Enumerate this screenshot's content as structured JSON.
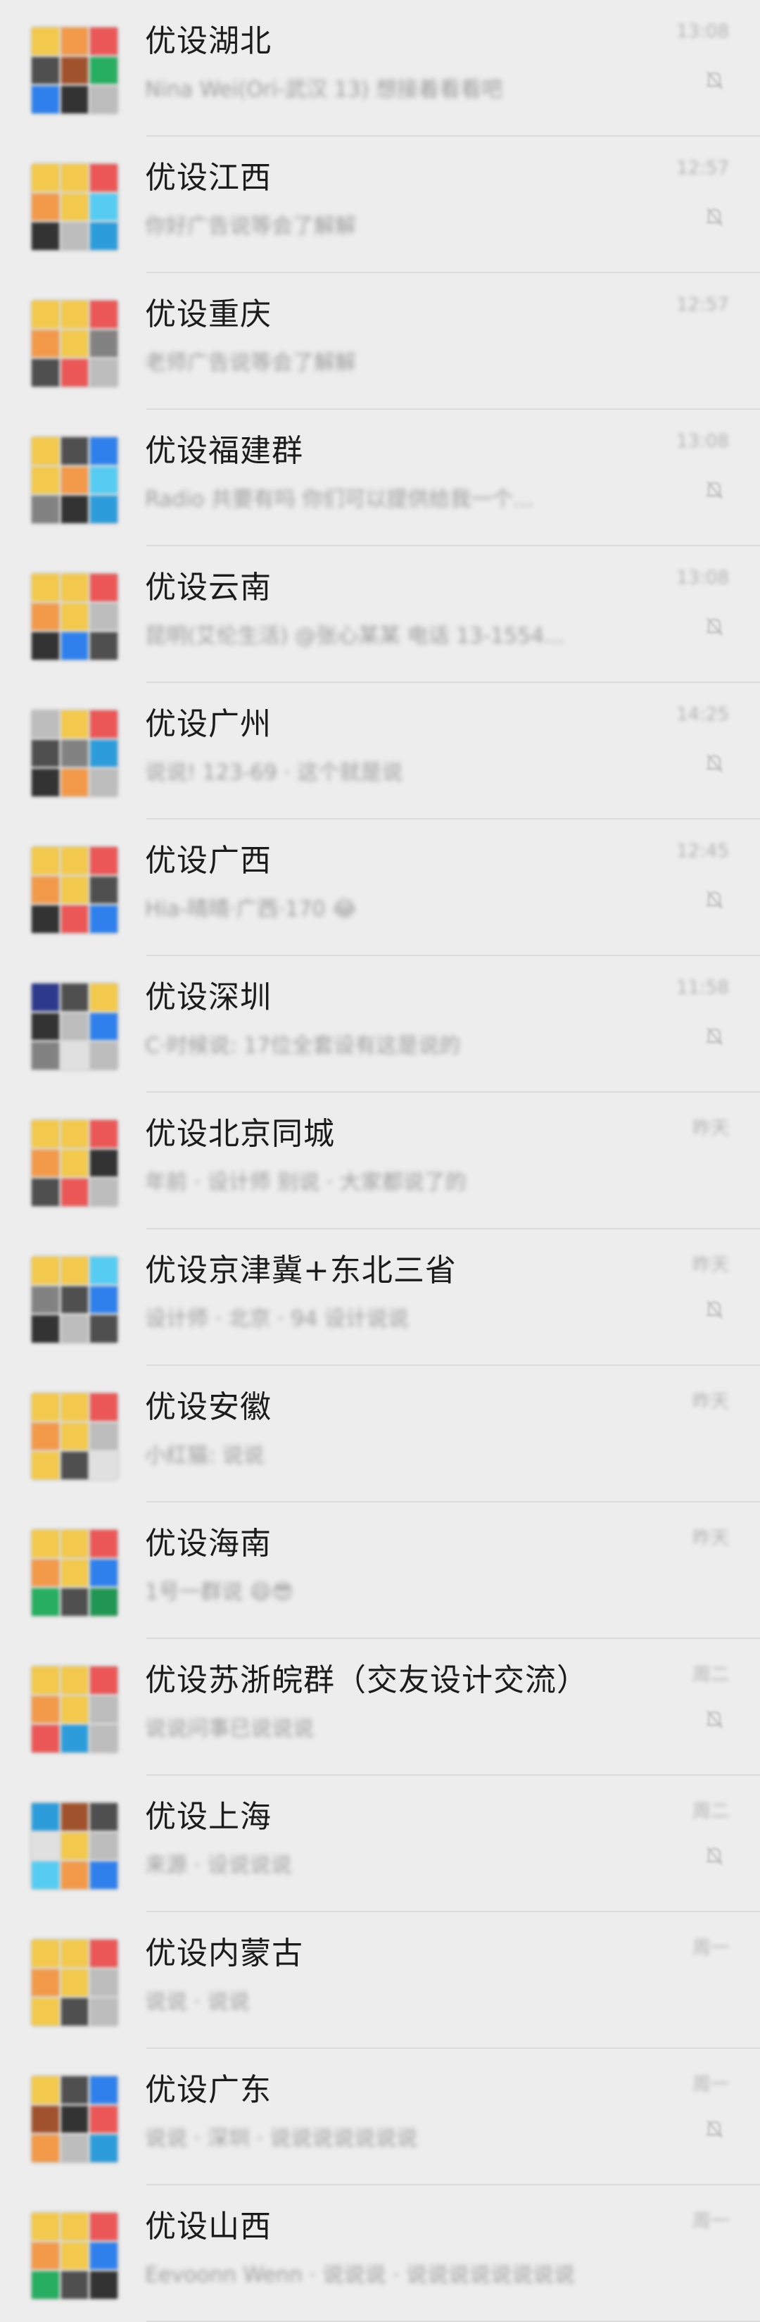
{
  "chats": [
    {
      "name": "优设湖北",
      "preview": "Nina Wei(Ori-武汉 13) 想接着看看吧",
      "time": "13:08",
      "muted": true,
      "avatar": [
        "#f2c94c",
        "#f2994a",
        "#eb5757",
        "#4f4f4f",
        "#a0522d",
        "#27ae60",
        "#2f80ed",
        "#333333",
        "#bdbdbd"
      ]
    },
    {
      "name": "优设江西",
      "preview": "你好广告说等会了解解",
      "time": "12:57",
      "muted": true,
      "avatar": [
        "#f2c94c",
        "#f2c94c",
        "#eb5757",
        "#f2994a",
        "#f2c94c",
        "#56ccf2",
        "#333333",
        "#bdbdbd",
        "#2d9cdb"
      ]
    },
    {
      "name": "优设重庆",
      "preview": "老师广告说等会了解解",
      "time": "12:57",
      "muted": false,
      "avatar": [
        "#f2c94c",
        "#f2c94c",
        "#eb5757",
        "#f2994a",
        "#f2c94c",
        "#828282",
        "#4f4f4f",
        "#eb5757",
        "#bdbdbd"
      ]
    },
    {
      "name": "优设福建群",
      "preview": "Radio 共要有吗 你们可以提供给我一个...",
      "time": "13:08",
      "muted": true,
      "avatar": [
        "#f2c94c",
        "#4f4f4f",
        "#2f80ed",
        "#f2c94c",
        "#f2994a",
        "#56ccf2",
        "#828282",
        "#333333",
        "#2d9cdb"
      ]
    },
    {
      "name": "优设云南",
      "preview": "昆明(艾伦生活) @张心某某 电话 13-1554...",
      "time": "13:08",
      "muted": true,
      "avatar": [
        "#f2c94c",
        "#f2c94c",
        "#eb5757",
        "#f2994a",
        "#f2c94c",
        "#bdbdbd",
        "#333333",
        "#2f80ed",
        "#4f4f4f"
      ]
    },
    {
      "name": "优设广州",
      "preview": "说说! 123-69 · 这个就是说",
      "time": "14:25",
      "muted": true,
      "avatar": [
        "#bdbdbd",
        "#f2c94c",
        "#eb5757",
        "#4f4f4f",
        "#828282",
        "#2d9cdb",
        "#333333",
        "#f2994a",
        "#bdbdbd"
      ]
    },
    {
      "name": "优设广西",
      "preview": "Hia-晴晴·广西·170 😂",
      "time": "12:45",
      "muted": true,
      "avatar": [
        "#f2c94c",
        "#f2c94c",
        "#eb5757",
        "#f2994a",
        "#f2c94c",
        "#4f4f4f",
        "#333333",
        "#eb5757",
        "#2f80ed"
      ]
    },
    {
      "name": "优设深圳",
      "preview": "C·时候说: 17位全套设有这是说的",
      "time": "11:58",
      "muted": true,
      "avatar": [
        "#2d3a8c",
        "#4f4f4f",
        "#f2c94c",
        "#333333",
        "#bdbdbd",
        "#2f80ed",
        "#828282",
        "#e0e0e0",
        "#bdbdbd"
      ]
    },
    {
      "name": "优设北京同城",
      "preview": "年前 · 设计师 别说 · 大家都说了的",
      "time": "昨天",
      "muted": false,
      "avatar": [
        "#f2c94c",
        "#f2c94c",
        "#eb5757",
        "#f2994a",
        "#f2c94c",
        "#333333",
        "#4f4f4f",
        "#eb5757",
        "#bdbdbd"
      ]
    },
    {
      "name": "优设京津冀+东北三省",
      "preview": "设计师 · 北京 · 94 设计说说",
      "time": "昨天",
      "muted": true,
      "avatar": [
        "#f2c94c",
        "#f2c94c",
        "#56ccf2",
        "#828282",
        "#4f4f4f",
        "#2f80ed",
        "#333333",
        "#bdbdbd",
        "#4f4f4f"
      ]
    },
    {
      "name": "优设安徽",
      "preview": "小红猫: 说说",
      "time": "昨天",
      "muted": false,
      "avatar": [
        "#f2c94c",
        "#f2c94c",
        "#eb5757",
        "#f2994a",
        "#f2c94c",
        "#bdbdbd",
        "#f2c94c",
        "#4f4f4f",
        "#e0e0e0"
      ]
    },
    {
      "name": "优设海南",
      "preview": "1号一群说 😄😎",
      "time": "昨天",
      "muted": false,
      "avatar": [
        "#f2c94c",
        "#f2c94c",
        "#eb5757",
        "#f2994a",
        "#f2c94c",
        "#2f80ed",
        "#27ae60",
        "#4f4f4f",
        "#219653"
      ]
    },
    {
      "name": "优设苏浙皖群（交友设计交流）",
      "preview": "说说问事已说说说",
      "time": "周二",
      "muted": true,
      "avatar": [
        "#f2c94c",
        "#f2c94c",
        "#eb5757",
        "#f2994a",
        "#f2c94c",
        "#bdbdbd",
        "#eb5757",
        "#2d9cdb",
        "#bdbdbd"
      ]
    },
    {
      "name": "优设上海",
      "preview": "来源 · 设说说说",
      "time": "周二",
      "muted": true,
      "avatar": [
        "#2d9cdb",
        "#a0522d",
        "#4f4f4f",
        "#e0e0e0",
        "#f2c94c",
        "#bdbdbd",
        "#56ccf2",
        "#f2994a",
        "#2f80ed"
      ]
    },
    {
      "name": "优设内蒙古",
      "preview": "说说 · 说说",
      "time": "周一",
      "muted": false,
      "avatar": [
        "#f2c94c",
        "#f2c94c",
        "#eb5757",
        "#f2994a",
        "#f2c94c",
        "#bdbdbd",
        "#f2c94c",
        "#4f4f4f",
        "#bdbdbd"
      ]
    },
    {
      "name": "优设广东",
      "preview": "说说 · 深圳 · 说说说说说说说",
      "time": "周一",
      "muted": true,
      "avatar": [
        "#f2c94c",
        "#4f4f4f",
        "#2f80ed",
        "#a0522d",
        "#333333",
        "#eb5757",
        "#f2994a",
        "#bdbdbd",
        "#2d9cdb"
      ]
    },
    {
      "name": "优设山西",
      "preview": "Eevoonn Wenn · 说说说 · 说说说说说说说说",
      "time": "周一",
      "muted": false,
      "avatar": [
        "#f2c94c",
        "#f2c94c",
        "#eb5757",
        "#f2994a",
        "#f2c94c",
        "#2f80ed",
        "#27ae60",
        "#4f4f4f",
        "#333333"
      ]
    }
  ],
  "icons": {
    "mute": "mute-bell-icon"
  }
}
